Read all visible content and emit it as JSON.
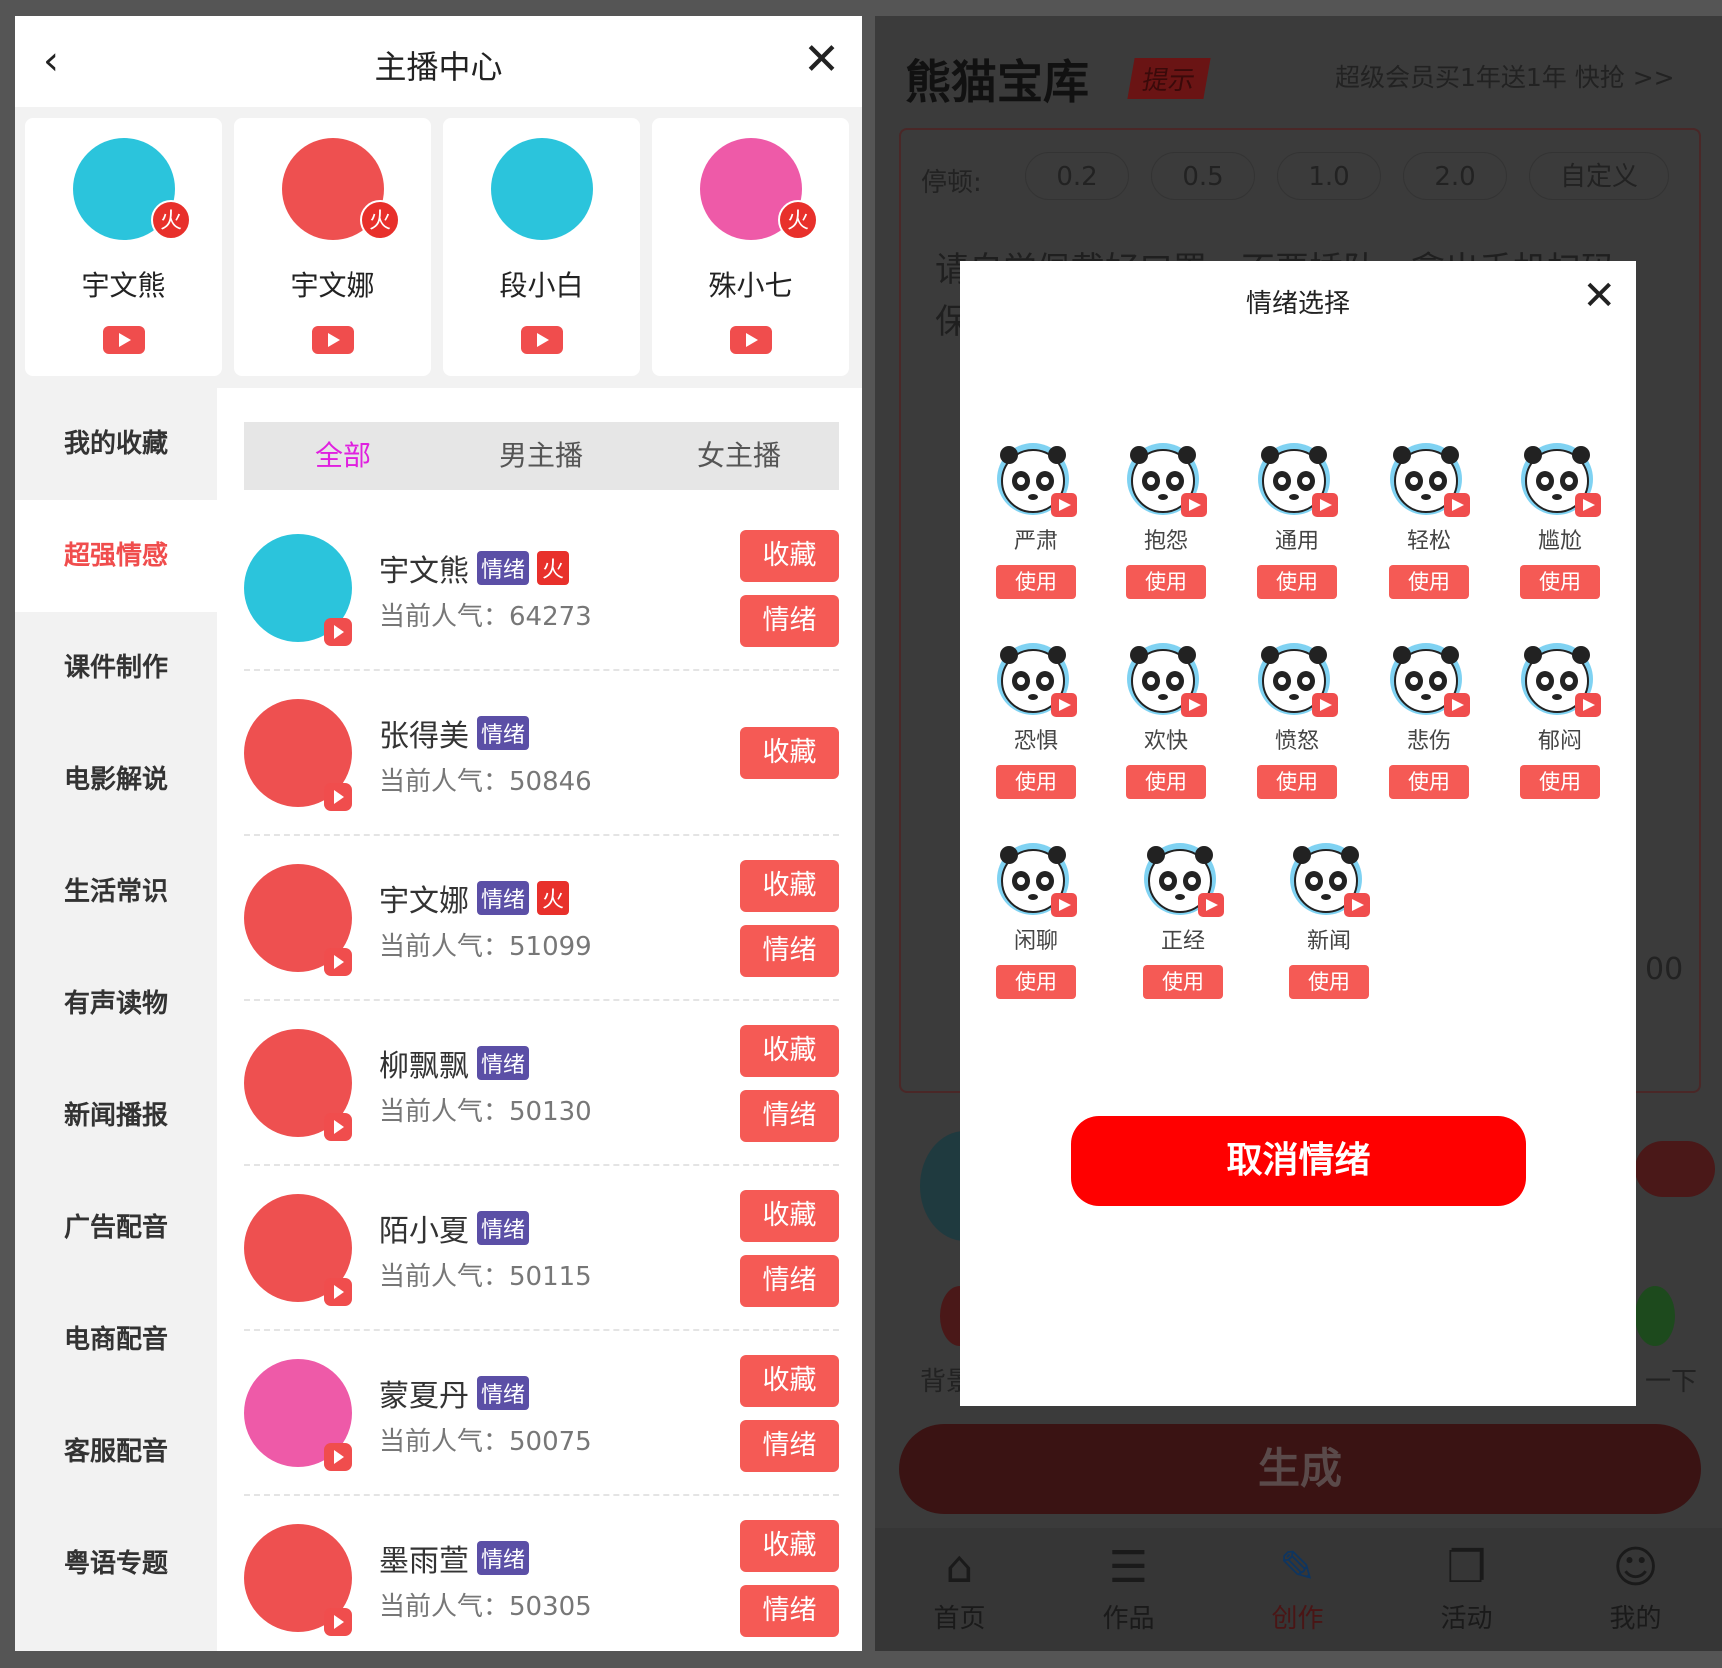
{
  "left": {
    "header": {
      "title": "主播中心",
      "back_icon": "chevron-left-icon",
      "close_icon": "close-icon"
    },
    "featured": [
      {
        "name": "宇文熊",
        "hot": "火",
        "color": "#2bc4dc"
      },
      {
        "name": "宇文娜",
        "hot": "火",
        "color": "#ee5050"
      },
      {
        "name": "段小白",
        "hot": "",
        "color": "#2bc4dc"
      },
      {
        "name": "殊小七",
        "hot": "火",
        "color": "#ee5aa8"
      }
    ],
    "sidebar": [
      {
        "label": "我的收藏"
      },
      {
        "label": "超强情感",
        "active": true
      },
      {
        "label": "课件制作"
      },
      {
        "label": "电影解说"
      },
      {
        "label": "生活常识"
      },
      {
        "label": "有声读物"
      },
      {
        "label": "新闻播报"
      },
      {
        "label": "广告配音"
      },
      {
        "label": "电商配音"
      },
      {
        "label": "客服配音"
      },
      {
        "label": "粤语专题"
      }
    ],
    "tabs": [
      {
        "label": "全部",
        "active": true
      },
      {
        "label": "男主播"
      },
      {
        "label": "女主播"
      }
    ],
    "popularity_label": "当前人气：",
    "badge_label": "情绪",
    "favorite_label": "收藏",
    "emotion_label": "情绪",
    "anchors": [
      {
        "name": "宇文熊",
        "hot": "火",
        "popularity": "64273",
        "emotion_btn": true,
        "color": "#2bc4dc"
      },
      {
        "name": "张得美",
        "hot": "",
        "popularity": "50846",
        "emotion_btn": false,
        "color": "#ee5050"
      },
      {
        "name": "宇文娜",
        "hot": "火",
        "popularity": "51099",
        "emotion_btn": true,
        "color": "#ee5050"
      },
      {
        "name": "柳飘飘",
        "hot": "",
        "popularity": "50130",
        "emotion_btn": true,
        "color": "#ee5050"
      },
      {
        "name": "陌小夏",
        "hot": "",
        "popularity": "50115",
        "emotion_btn": true,
        "color": "#ee5050"
      },
      {
        "name": "蒙夏丹",
        "hot": "",
        "popularity": "50075",
        "emotion_btn": true,
        "color": "#ee5aa8"
      },
      {
        "name": "墨雨萱",
        "hot": "",
        "popularity": "50305",
        "emotion_btn": true,
        "color": "#ee5050"
      }
    ]
  },
  "right": {
    "brand": "熊猫宝库",
    "tip": "提示",
    "promo": "超级会员买1年送1年  快抢 >>",
    "pause_label": "停顿:",
    "pause_options": [
      "0.2",
      "0.5",
      "1.0",
      "2.0",
      "自定义"
    ],
    "text_line1": "请自觉佩戴好口罩，不要插队，拿出手机扫码",
    "text_line2": "保",
    "count_fragment": "00",
    "bg_left": "背景",
    "bg_right": "一下",
    "generate": "生成",
    "nav": [
      {
        "label": "首页",
        "icon": "store-icon"
      },
      {
        "label": "作品",
        "icon": "document-icon"
      },
      {
        "label": "创作",
        "icon": "pen-icon",
        "active": true
      },
      {
        "label": "活动",
        "icon": "gift-icon"
      },
      {
        "label": "我的",
        "icon": "user-icon"
      }
    ]
  },
  "modal": {
    "title": "情绪选择",
    "use_label": "使用",
    "emotions": [
      "严肃",
      "抱怨",
      "通用",
      "轻松",
      "尴尬",
      "恐惧",
      "欢快",
      "愤怒",
      "悲伤",
      "郁闷",
      "闲聊",
      "正经",
      "新闻"
    ],
    "cancel": "取消情绪"
  },
  "colors": {
    "accent": "#f55a55",
    "badge": "#5b4fa6",
    "cancel": "#ff0000",
    "tab_active": "#e020e0"
  }
}
